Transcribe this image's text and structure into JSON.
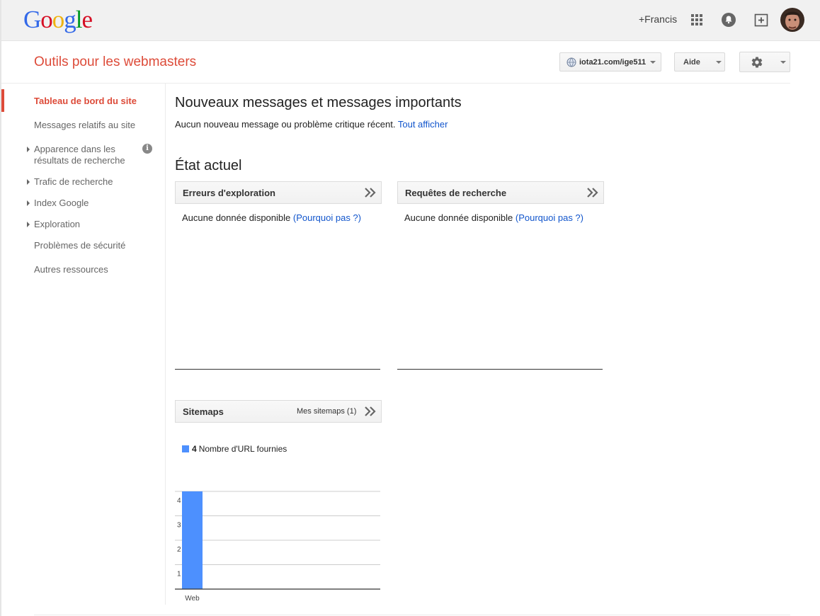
{
  "topbar": {
    "logo_letters": [
      {
        "ch": "G",
        "color": "#3369e8"
      },
      {
        "ch": "o",
        "color": "#d50f25"
      },
      {
        "ch": "o",
        "color": "#eeb211"
      },
      {
        "ch": "g",
        "color": "#3369e8"
      },
      {
        "ch": "l",
        "color": "#009925"
      },
      {
        "ch": "e",
        "color": "#d50f25"
      }
    ],
    "plus_name": "+Francis",
    "icons": [
      "apps-icon",
      "notifications-bell-icon",
      "share-plus-icon",
      "avatar"
    ]
  },
  "header": {
    "app_title": "Outils pour les webmasters",
    "site_selector": "iota21.com/ige511",
    "help_label": "Aide",
    "settings_icon": "gear-icon"
  },
  "sidebar": {
    "items": [
      {
        "label": "Tableau de bord du site",
        "active": true,
        "expandable": false
      },
      {
        "label": "Messages relatifs au site",
        "active": false,
        "expandable": false
      },
      {
        "label": "Apparence dans les résultats de recherche",
        "active": false,
        "expandable": true,
        "info": "i"
      },
      {
        "label": "Trafic de recherche",
        "active": false,
        "expandable": true
      },
      {
        "label": "Index Google",
        "active": false,
        "expandable": true
      },
      {
        "label": "Exploration",
        "active": false,
        "expandable": true
      },
      {
        "label": "Problèmes de sécurité",
        "active": false,
        "expandable": false
      },
      {
        "label": "Autres ressources",
        "active": false,
        "expandable": false
      }
    ]
  },
  "main": {
    "messages_title": "Nouveaux messages et messages importants",
    "messages_text": "Aucun nouveau message ou problème critique récent.",
    "messages_link": "Tout afficher",
    "status_title": "État actuel",
    "crawl_errors": {
      "title": "Erreurs d'exploration",
      "text": "Aucune donnée disponible",
      "link": "(Pourquoi pas ?)"
    },
    "search_queries": {
      "title": "Requêtes de recherche",
      "text": "Aucune donnée disponible",
      "link": "(Pourquoi pas ?)"
    },
    "sitemaps": {
      "title": "Sitemaps",
      "link": "Mes sitemaps (1)",
      "legend_value": "4",
      "legend_label": "Nombre d'URL fournies"
    }
  },
  "colors": {
    "accent": "#dd4b39",
    "link": "#1155cc",
    "bar": "#4d90fe"
  },
  "chart_data": {
    "type": "bar",
    "categories": [
      "Web"
    ],
    "series": [
      {
        "name": "Nombre d'URL fournies",
        "values": [
          4
        ]
      }
    ],
    "ylim": [
      0,
      4
    ],
    "yticks": [
      1,
      2,
      3,
      4
    ],
    "grid": true
  }
}
